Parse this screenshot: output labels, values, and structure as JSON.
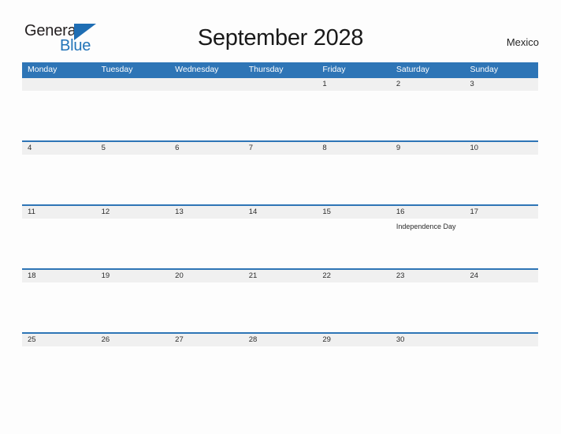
{
  "brand": {
    "name_part1": "General",
    "name_part2": "Blue",
    "accent_color": "#2274b8"
  },
  "header": {
    "title": "September 2028",
    "country": "Mexico"
  },
  "theme": {
    "header_blue": "#2e75b6",
    "row_line_blue": "#2e75b6",
    "date_band_gray": "#f0f0f0",
    "page_background": "#fdfdfd"
  },
  "weekday_headers": [
    "Monday",
    "Tuesday",
    "Wednesday",
    "Thursday",
    "Friday",
    "Saturday",
    "Sunday"
  ],
  "weeks": [
    [
      {
        "day": "",
        "events": []
      },
      {
        "day": "",
        "events": []
      },
      {
        "day": "",
        "events": []
      },
      {
        "day": "",
        "events": []
      },
      {
        "day": "1",
        "events": []
      },
      {
        "day": "2",
        "events": []
      },
      {
        "day": "3",
        "events": []
      }
    ],
    [
      {
        "day": "4",
        "events": []
      },
      {
        "day": "5",
        "events": []
      },
      {
        "day": "6",
        "events": []
      },
      {
        "day": "7",
        "events": []
      },
      {
        "day": "8",
        "events": []
      },
      {
        "day": "9",
        "events": []
      },
      {
        "day": "10",
        "events": []
      }
    ],
    [
      {
        "day": "11",
        "events": []
      },
      {
        "day": "12",
        "events": []
      },
      {
        "day": "13",
        "events": []
      },
      {
        "day": "14",
        "events": []
      },
      {
        "day": "15",
        "events": []
      },
      {
        "day": "16",
        "events": [
          "Independence Day"
        ]
      },
      {
        "day": "17",
        "events": []
      }
    ],
    [
      {
        "day": "18",
        "events": []
      },
      {
        "day": "19",
        "events": []
      },
      {
        "day": "20",
        "events": []
      },
      {
        "day": "21",
        "events": []
      },
      {
        "day": "22",
        "events": []
      },
      {
        "day": "23",
        "events": []
      },
      {
        "day": "24",
        "events": []
      }
    ],
    [
      {
        "day": "25",
        "events": []
      },
      {
        "day": "26",
        "events": []
      },
      {
        "day": "27",
        "events": []
      },
      {
        "day": "28",
        "events": []
      },
      {
        "day": "29",
        "events": []
      },
      {
        "day": "30",
        "events": []
      },
      {
        "day": "",
        "events": []
      }
    ]
  ]
}
